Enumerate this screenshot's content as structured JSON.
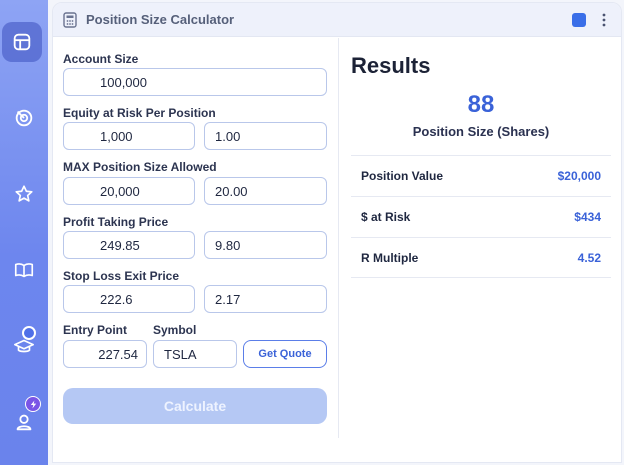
{
  "sidebar": {
    "items": [
      {
        "icon": "layout-icon"
      },
      {
        "icon": "target-icon"
      },
      {
        "icon": "star-icon"
      },
      {
        "icon": "book-icon"
      },
      {
        "icon": "graduation-cap-icon"
      },
      {
        "icon": "user-icon"
      }
    ]
  },
  "window": {
    "title": "Position Size Calculator",
    "title_icon": "calculator-icon",
    "status_color": "#3a6ee8"
  },
  "form": {
    "account_size": {
      "label": "Account Size",
      "value": "100,000"
    },
    "equity_at_risk": {
      "label": "Equity at Risk Per Position",
      "value": "1,000",
      "percent": "1.00"
    },
    "max_position": {
      "label": "MAX Position Size Allowed",
      "value": "20,000",
      "percent": "20.00"
    },
    "profit_taking": {
      "label": "Profit Taking Price",
      "value": "249.85",
      "percent": "9.80"
    },
    "stop_loss": {
      "label": "Stop Loss Exit Price",
      "value": "222.6",
      "percent": "2.17"
    },
    "entry_point": {
      "label": "Entry Point",
      "value": "227.54"
    },
    "symbol": {
      "label": "Symbol",
      "value": "TSLA"
    },
    "get_quote_label": "Get Quote",
    "calculate_label": "Calculate"
  },
  "results": {
    "title": "Results",
    "position_size": "88",
    "position_size_label": "Position Size (Shares)",
    "rows": [
      {
        "label": "Position Value",
        "value": "$20,000"
      },
      {
        "label": "$ at Risk",
        "value": "$434"
      },
      {
        "label": "R Multiple",
        "value": "4.52"
      }
    ]
  },
  "colors": {
    "accent": "#3a62d8",
    "sidebar": "#6d86ee",
    "button_disabled": "#b5c8f4"
  }
}
